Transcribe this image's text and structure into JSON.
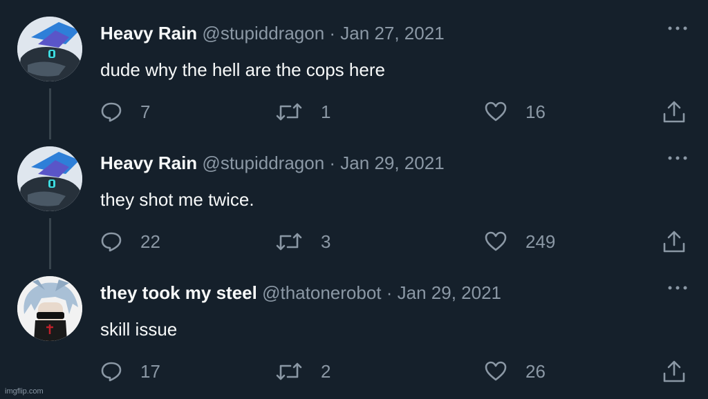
{
  "tweets": [
    {
      "name": "Heavy Rain",
      "handle": "@stupiddragon",
      "separator": "·",
      "date": "Jan 27, 2021",
      "text": "dude why the hell are the cops here",
      "replies": "7",
      "retweets": "1",
      "likes": "16",
      "avatar_icon": "dragon-avatar"
    },
    {
      "name": "Heavy Rain",
      "handle": "@stupiddragon",
      "separator": "·",
      "date": "Jan 29, 2021",
      "text": "they shot me twice.",
      "replies": "22",
      "retweets": "3",
      "likes": "249",
      "avatar_icon": "dragon-avatar"
    },
    {
      "name": "they took my steel",
      "handle": "@thatonerobot",
      "separator": "·",
      "date": "Jan 29, 2021",
      "text": "skill issue",
      "replies": "17",
      "retweets": "2",
      "likes": "26",
      "avatar_icon": "masked-character-avatar"
    }
  ],
  "watermark": "imgflip.com",
  "colors": {
    "background": "#15202b",
    "primary_text": "#f7f9f9",
    "secondary_text": "#8b98a5",
    "thread_line": "#38444d"
  },
  "icons": [
    "reply-icon",
    "retweet-icon",
    "like-icon",
    "share-icon",
    "more-icon"
  ]
}
